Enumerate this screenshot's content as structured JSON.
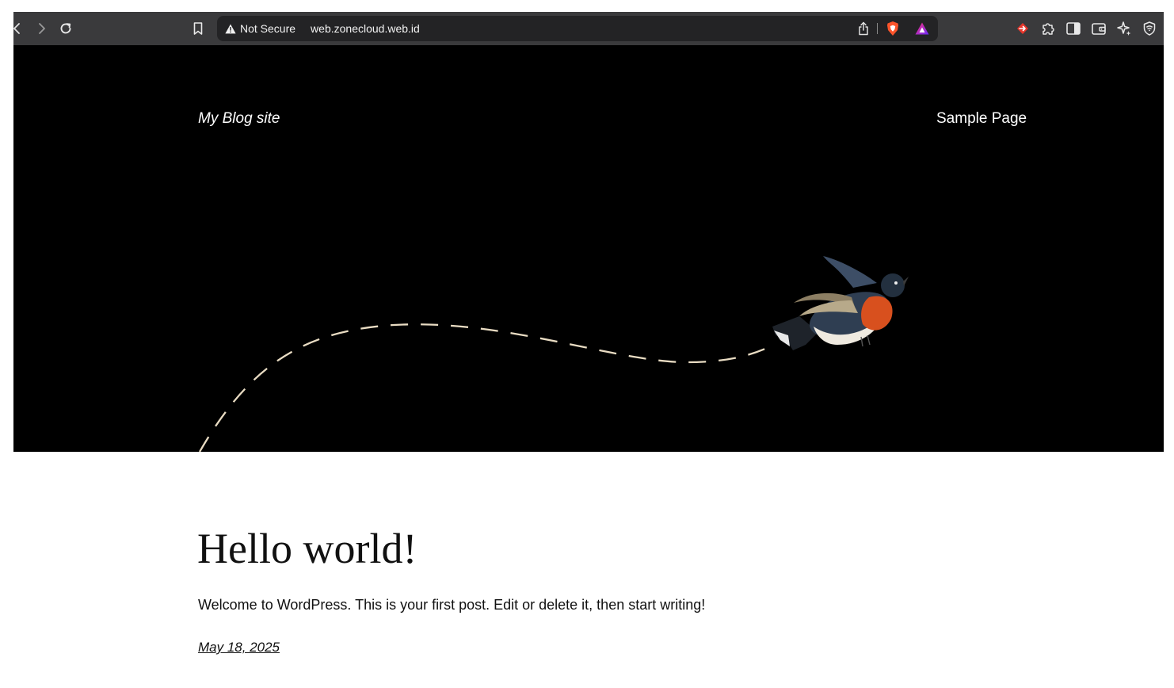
{
  "browser": {
    "address": {
      "security_label": "Not Secure",
      "url": "web.zonecloud.web.id"
    },
    "icons": {
      "back": "chevron-left-icon",
      "forward": "chevron-right-icon",
      "reload": "reload-icon",
      "bookmark": "bookmark-icon",
      "share": "share-icon",
      "brave_shields": "brave-shield-icon",
      "brave_rewards": "brave-rewards-icon",
      "extensions": [
        "red-arrow-extension-icon",
        "puzzle-icon",
        "sidebar-icon",
        "wallet-icon",
        "sparkle-icon",
        "vpn-shield-icon"
      ]
    },
    "colors": {
      "toolbar": "#3a3a3c",
      "address_bg": "#232325",
      "brave_orange": "#fb542b"
    }
  },
  "site": {
    "title": "My Blog site",
    "nav": [
      "Sample Page"
    ],
    "colors": {
      "header_bg": "#000000",
      "dash_line": "#e9dcc3"
    }
  },
  "post": {
    "title": "Hello world!",
    "excerpt": "Welcome to WordPress. This is your first post. Edit or delete it, then start writing!",
    "date": "May 18, 2025"
  }
}
